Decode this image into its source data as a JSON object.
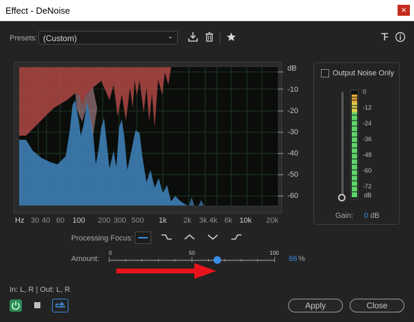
{
  "window": {
    "title": "Effect - DeNoise",
    "close_icon": "×"
  },
  "presets": {
    "label": "Presets:",
    "value": "(Custom)"
  },
  "graph": {
    "y_labels": [
      "dB",
      "-10",
      "-20",
      "-30",
      "-40",
      "-50",
      "-60"
    ],
    "x_labels": [
      "Hz",
      "30",
      "40",
      "60",
      "100",
      "200",
      "300",
      "500",
      "1k",
      "2k",
      "3k",
      "4k",
      "6k",
      "10k",
      "20k"
    ]
  },
  "output_noise": {
    "label": "Output Noise Only",
    "checked": false
  },
  "meter": {
    "scale": [
      "0",
      "-12",
      "-24",
      "-36",
      "-48",
      "-60",
      "-72",
      "dB"
    ],
    "gain_label": "Gain:",
    "gain_value": "0",
    "gain_unit": "dB"
  },
  "processing_focus": {
    "label": "Processing Focus:"
  },
  "amount": {
    "label": "Amount:",
    "tick_labels": [
      "0",
      "50",
      "100"
    ],
    "value": "66",
    "unit": "%"
  },
  "io": {
    "label": "In: L, R | Out: L, R"
  },
  "buttons": {
    "apply": "Apply",
    "close": "Close"
  },
  "colors": {
    "accent": "#3a8ee6",
    "noise_fill": "#b54a47",
    "signal_fill": "#3f82b8",
    "arrow": "#e8141b"
  }
}
